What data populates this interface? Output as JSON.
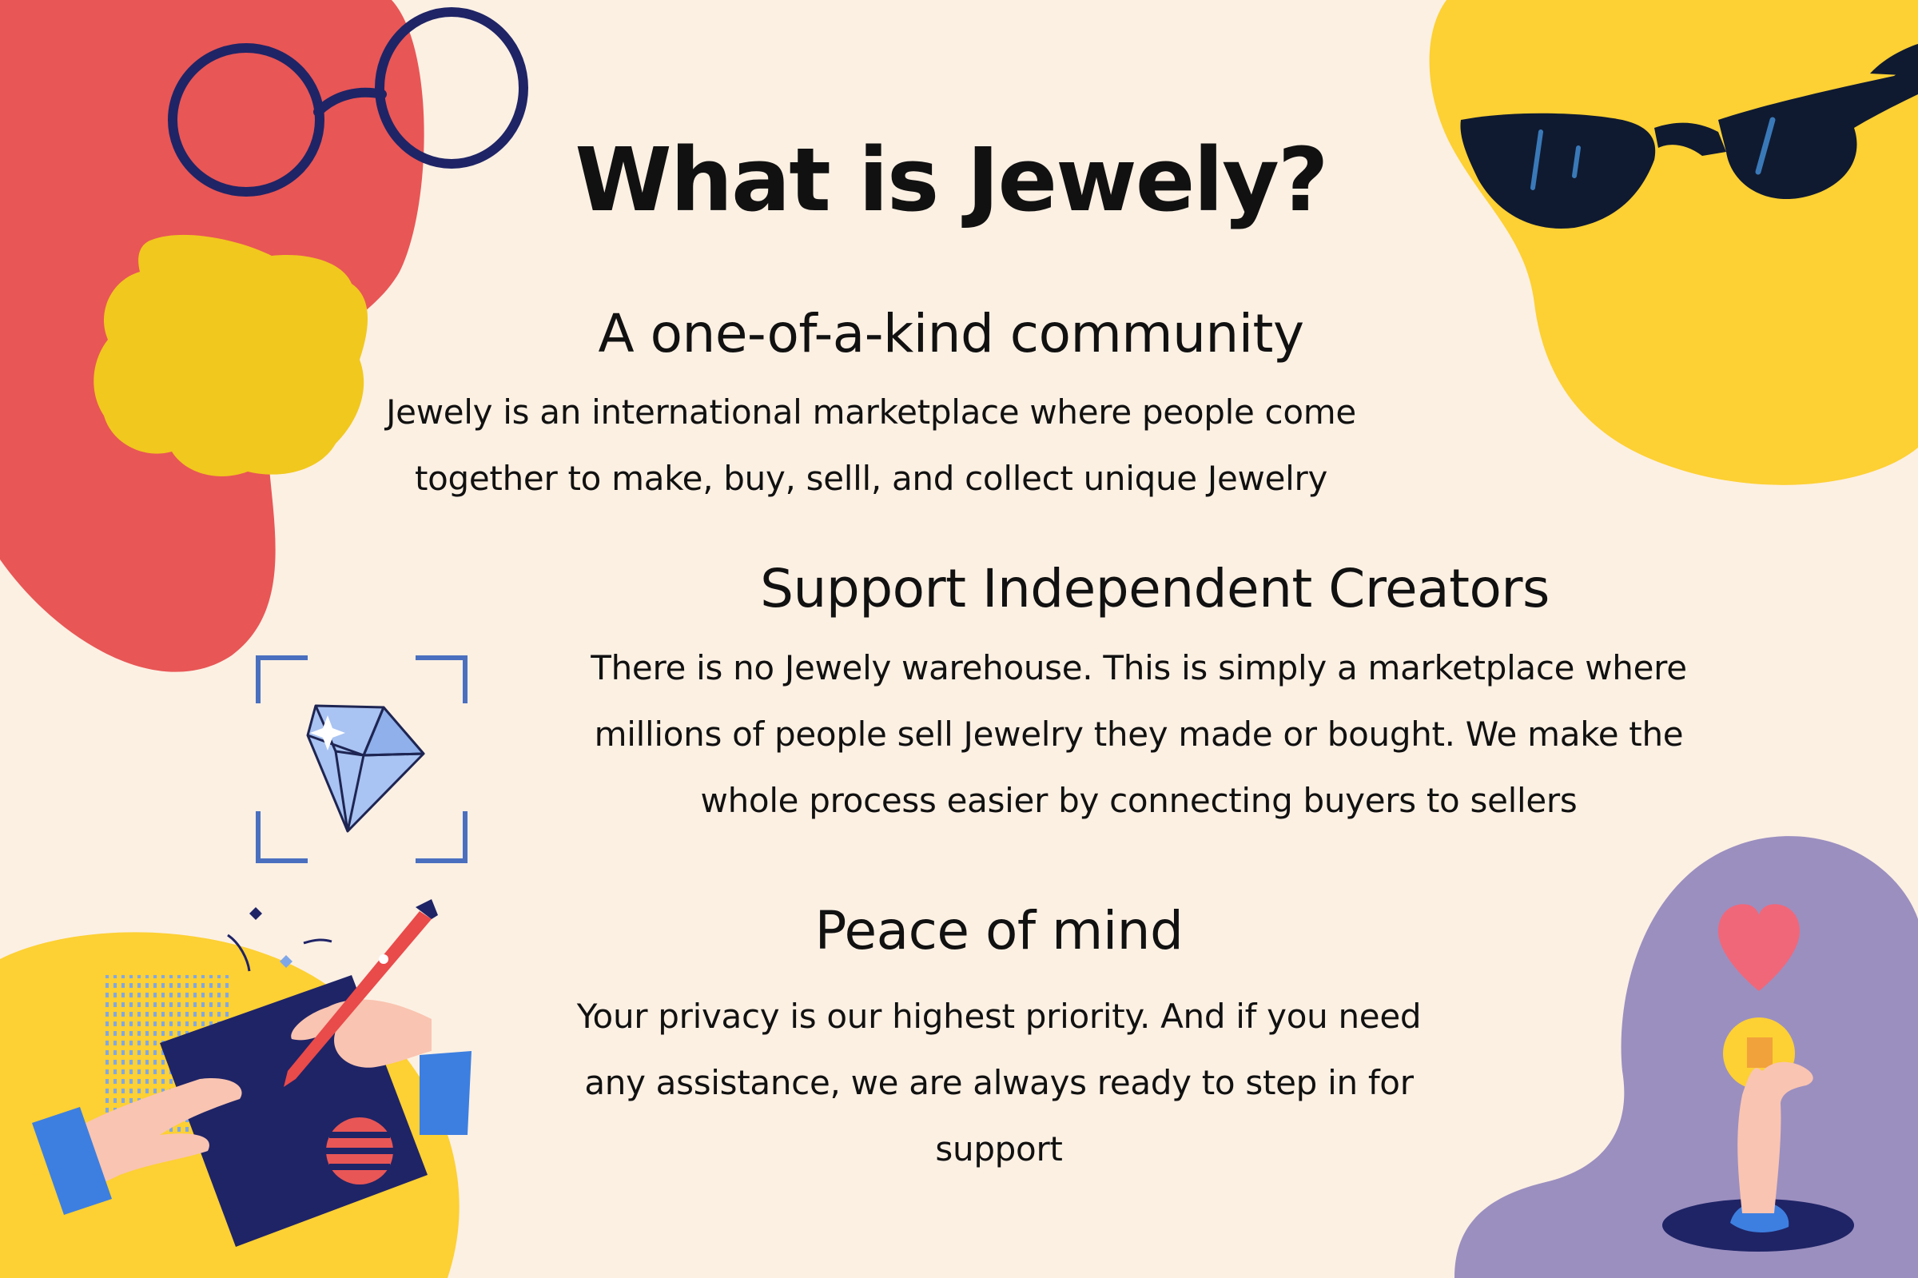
{
  "title": "What is Jewely?",
  "sections": [
    {
      "heading": "A one-of-a-kind community",
      "lines": [
        "Jewely is an international marketplace where people come",
        "together to make, buy, selll, and collect unique Jewelry"
      ]
    },
    {
      "heading": "Support Independent Creators",
      "lines": [
        "There is no Jewely warehouse. This is simply a marketplace where",
        "millions of people sell Jewelry they made or bought. We make the",
        "whole process easier by connecting buyers to sellers"
      ]
    },
    {
      "heading": "Peace of mind",
      "lines": [
        "Your privacy is our highest priority. And if you need",
        "any assistance, we are always ready to step in for",
        "support"
      ]
    }
  ],
  "illustrations": [
    "glasses-icon",
    "sunglasses-icon",
    "diamond-icon",
    "hand-drawing-icon",
    "heart-icon",
    "coin-icon"
  ],
  "colors": {
    "background": "#FCF0E3",
    "red": "#E85656",
    "yellow": "#FDD034",
    "mustard": "#F1C81E",
    "navy": "#1F2466",
    "dark": "#0F1A30",
    "purple": "#9B8FC0",
    "blue": "#4A6FBF",
    "heart": "#F0677A"
  }
}
